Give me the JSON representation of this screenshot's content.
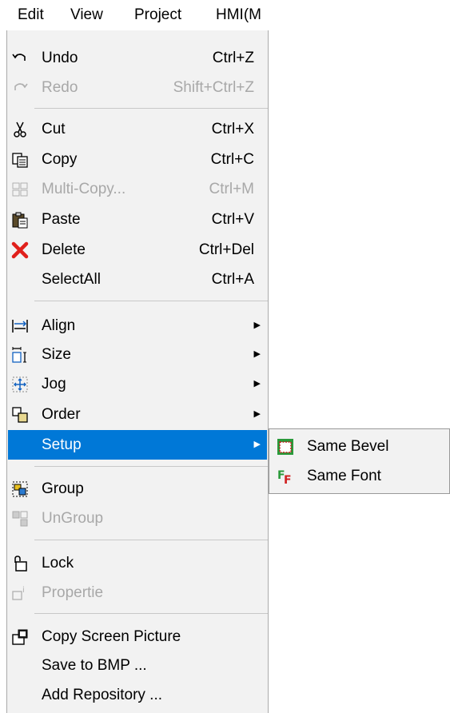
{
  "menubar": {
    "items": [
      "Edit",
      "View",
      "Project",
      "HMI(M"
    ]
  },
  "menu": {
    "items": [
      {
        "label": "Undo",
        "shortcut": "Ctrl+Z",
        "icon": "undo-icon",
        "disabled": false
      },
      {
        "label": "Redo",
        "shortcut": "Shift+Ctrl+Z",
        "icon": "redo-icon",
        "disabled": true
      },
      {
        "label": "Cut",
        "shortcut": "Ctrl+X",
        "icon": "scissors-icon",
        "disabled": false
      },
      {
        "label": "Copy",
        "shortcut": "Ctrl+C",
        "icon": "copy-icon",
        "disabled": false
      },
      {
        "label": "Multi-Copy...",
        "shortcut": "Ctrl+M",
        "icon": "multi-copy-icon",
        "disabled": true
      },
      {
        "label": "Paste",
        "shortcut": "Ctrl+V",
        "icon": "paste-icon",
        "disabled": false
      },
      {
        "label": "Delete",
        "shortcut": "Ctrl+Del",
        "icon": "delete-x-icon",
        "disabled": false
      },
      {
        "label": "SelectAll",
        "shortcut": "Ctrl+A",
        "icon": "",
        "disabled": false
      },
      {
        "label": "Align",
        "icon": "align-icon",
        "submenu": true
      },
      {
        "label": "Size",
        "icon": "size-icon",
        "submenu": true
      },
      {
        "label": "Jog",
        "icon": "jog-icon",
        "submenu": true
      },
      {
        "label": "Order",
        "icon": "order-icon",
        "submenu": true
      },
      {
        "label": "Setup",
        "icon": "",
        "submenu": true,
        "highlighted": true
      },
      {
        "label": "Group",
        "icon": "group-icon",
        "disabled": false
      },
      {
        "label": "UnGroup",
        "icon": "ungroup-icon",
        "disabled": true
      },
      {
        "label": "Lock",
        "icon": "lock-icon",
        "disabled": false
      },
      {
        "label": "Propertie",
        "icon": "properties-icon",
        "disabled": true
      },
      {
        "label": "Copy Screen Picture",
        "icon": "copy-screen-icon",
        "disabled": false
      },
      {
        "label": "Save to BMP ...",
        "icon": "",
        "disabled": false
      },
      {
        "label": "Add Repository ...",
        "icon": "",
        "disabled": false
      }
    ]
  },
  "submenu": {
    "items": [
      {
        "label": "Same Bevel",
        "icon": "bevel-icon"
      },
      {
        "label": "Same Font",
        "icon": "font-icon"
      }
    ]
  },
  "colors": {
    "highlight": "#0078d7",
    "menu_bg": "#f2f2f2",
    "disabled_text": "#a8a8a8",
    "delete_red": "#e0201b"
  }
}
